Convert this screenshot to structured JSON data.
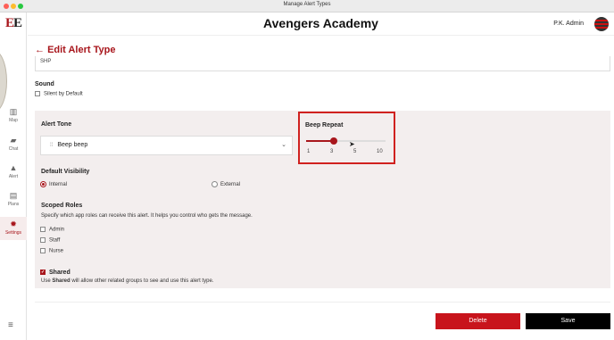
{
  "window": {
    "title": "Manage Alert Types"
  },
  "traffic_colors": [
    "#fe5f57",
    "#febc2e",
    "#28c840"
  ],
  "sidebar": {
    "logo": "E",
    "logo_accent": "E",
    "items": [
      {
        "label": "Map",
        "icon": "map-icon"
      },
      {
        "label": "Chat",
        "icon": "chat-icon"
      },
      {
        "label": "Alert",
        "icon": "alert-icon"
      },
      {
        "label": "Plans",
        "icon": "plans-icon"
      },
      {
        "label": "Settings",
        "icon": "gear-icon"
      }
    ]
  },
  "header": {
    "app_title": "Avengers Academy",
    "user_name": "P.K. Admin"
  },
  "page": {
    "title": "Edit Alert Type",
    "back_arrow": "←"
  },
  "form": {
    "code_value": "SHP",
    "sound": {
      "label": "Sound",
      "silent_label": "Silent by Default",
      "silent_checked": false
    },
    "alert_tone": {
      "label": "Alert Tone",
      "value": "Beep beep"
    },
    "beep_repeat": {
      "label": "Beep Repeat",
      "ticks": [
        "1",
        "3",
        "5",
        "10"
      ],
      "value": "3"
    },
    "visibility": {
      "label": "Default Visibility",
      "options": [
        "Internal",
        "External"
      ],
      "selected": "Internal"
    },
    "scoped_roles": {
      "label": "Scoped Roles",
      "description": "Specify which app roles can receive this alert. It helps you control who gets the message.",
      "roles": [
        "Admin",
        "Staff",
        "Nurse"
      ]
    },
    "shared": {
      "label": "Shared",
      "checked": true,
      "desc_prefix": "Use ",
      "desc_bold": "Shared",
      "desc_suffix": " will allow other related groups to see and use this alert type."
    }
  },
  "actions": {
    "delete_label": "Delete",
    "save_label": "Save"
  },
  "colors": {
    "accent": "#a8161c",
    "highlight": "#d0211f",
    "delete": "#c8141c",
    "save": "#000000"
  }
}
